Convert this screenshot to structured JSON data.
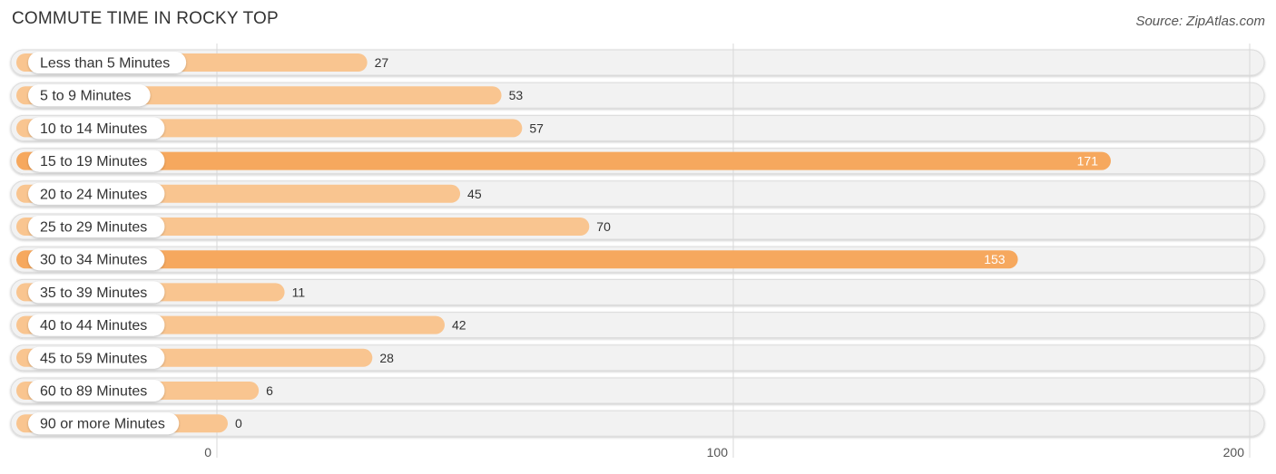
{
  "chart_data": {
    "type": "bar",
    "orientation": "horizontal",
    "title": "COMMUTE TIME IN ROCKY TOP",
    "source": "Source: ZipAtlas.com",
    "categories": [
      "Less than 5 Minutes",
      "5 to 9 Minutes",
      "10 to 14 Minutes",
      "15 to 19 Minutes",
      "20 to 24 Minutes",
      "25 to 29 Minutes",
      "30 to 34 Minutes",
      "35 to 39 Minutes",
      "40 to 44 Minutes",
      "45 to 59 Minutes",
      "60 to 89 Minutes",
      "90 or more Minutes"
    ],
    "values": [
      27,
      53,
      57,
      171,
      45,
      70,
      153,
      11,
      42,
      28,
      6,
      0
    ],
    "xlim": [
      0,
      200
    ],
    "xticks": [
      0,
      100,
      200
    ],
    "xlabel": "",
    "ylabel": "",
    "grid": true,
    "colors": {
      "bar": "#f9c590",
      "bar_highlight": "#f6a85e",
      "track": "#f2f2f2",
      "label_inside": "#ffffff",
      "label_outside": "#333333"
    },
    "highlight_threshold": 150
  }
}
